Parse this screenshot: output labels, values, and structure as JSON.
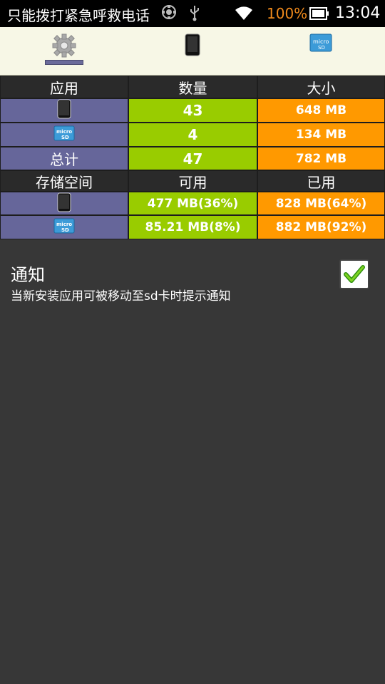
{
  "status_bar": {
    "carrier_text": "只能拨打紧急呼救电话",
    "battery_percent": "100%",
    "time": "13:04",
    "icons": [
      "sim-icon",
      "usb-icon",
      "wifi-icon",
      "battery-icon"
    ]
  },
  "tabs": [
    {
      "name": "settings",
      "icon": "gear-icon",
      "selected": true
    },
    {
      "name": "phone",
      "icon": "phone-icon",
      "selected": false
    },
    {
      "name": "sdcard",
      "icon": "microsd-icon",
      "selected": false
    }
  ],
  "table": {
    "header1": {
      "col1": "应用",
      "col2": "数量",
      "col3": "大小"
    },
    "rows": [
      {
        "icon": "phone-icon",
        "count": "43",
        "size": "648 MB"
      },
      {
        "icon": "microsd-icon",
        "count": "4",
        "size": "134 MB"
      },
      {
        "label": "总计",
        "count": "47",
        "size": "782 MB"
      }
    ],
    "header2": {
      "col1": "存储空间",
      "col2": "可用",
      "col3": "已用"
    },
    "storage": [
      {
        "icon": "phone-icon",
        "available": "477 MB(36%)",
        "used": "828 MB(64%)"
      },
      {
        "icon": "microsd-icon",
        "available": "85.21 MB(8%)",
        "used": "882 MB(92%)"
      }
    ]
  },
  "notification": {
    "title": "通知",
    "description": "当新安装应用可被移动至sd卡时提示通知",
    "checked": true
  },
  "colors": {
    "purple": "#66669a",
    "green": "#99cc00",
    "orange": "#ff9900",
    "background": "#373737",
    "tabbar": "#f7f7e6"
  }
}
